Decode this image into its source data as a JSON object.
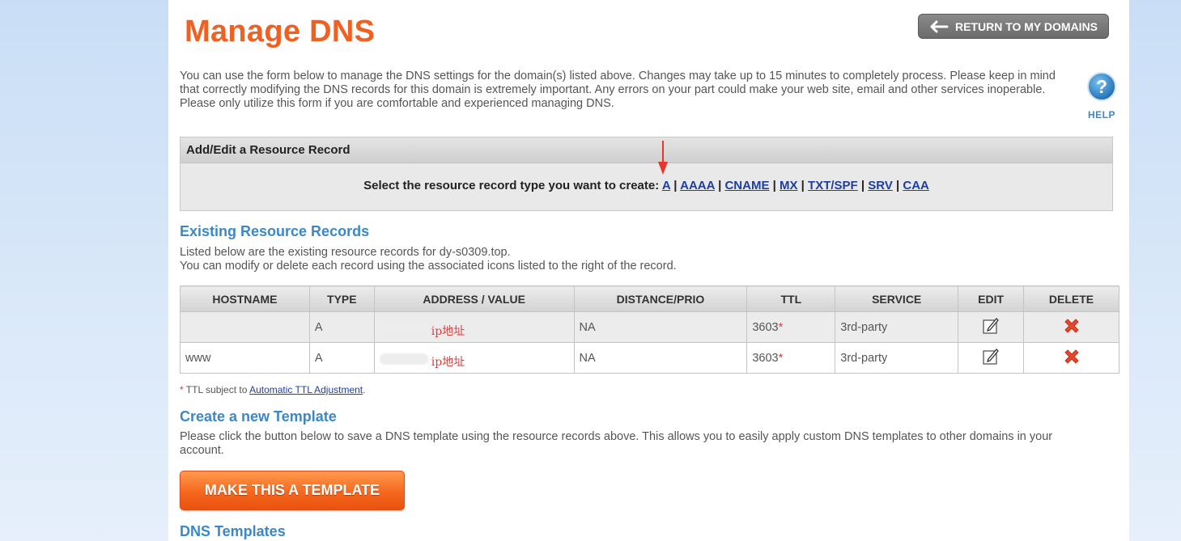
{
  "page": {
    "title": "Manage DNS",
    "return_button": "RETURN TO MY DOMAINS",
    "intro": "You can use the form below to manage the DNS settings for the domain(s) listed above. Changes may take up to 15 minutes to completely process. Please keep in mind that correctly modifying the DNS records for this domain is extremely important. Any errors on your part could make your web site, email and other services inoperable. Please only utilize this form if you are comfortable and experienced managing DNS.",
    "help_label": "HELP"
  },
  "add_record": {
    "header": "Add/Edit a Resource Record",
    "prompt": "Select the resource record type you want to create:",
    "types": [
      "A",
      "AAAA",
      "CNAME",
      "MX",
      "TXT/SPF",
      "SRV",
      "CAA"
    ]
  },
  "existing": {
    "title": "Existing Resource Records",
    "line1": "Listed below are the existing resource records for dy-s0309.top.",
    "line2": "You can modify or delete each record using the associated icons listed to the right of the record.",
    "columns": [
      "HOSTNAME",
      "TYPE",
      "ADDRESS / VALUE",
      "DISTANCE/PRIO",
      "TTL",
      "EDIT",
      "SERVICE",
      "DELETE"
    ],
    "headers": {
      "hostname": "HOSTNAME",
      "type": "TYPE",
      "address": "ADDRESS / VALUE",
      "distance": "DISTANCE/PRIO",
      "ttl": "TTL",
      "service": "SERVICE",
      "edit": "EDIT",
      "delete": "DELETE"
    },
    "rows": [
      {
        "hostname": "",
        "type": "A",
        "address_note": "ip地址",
        "distance": "NA",
        "ttl": "3603",
        "ttl_mark": "*",
        "service": "3rd-party"
      },
      {
        "hostname": "www",
        "type": "A",
        "address_note": "ip地址",
        "distance": "NA",
        "ttl": "3603",
        "ttl_mark": "*",
        "service": "3rd-party"
      }
    ],
    "ttl_note_mark": "*",
    "ttl_note_prefix": "TTL subject to",
    "ttl_note_link": "Automatic TTL Adjustment",
    "ttl_note_suffix": "."
  },
  "template": {
    "title": "Create a new Template",
    "description": "Please click the button below to save a DNS template using the resource records above. This allows you to easily apply custom DNS templates to other domains in your account.",
    "button": "MAKE THIS A TEMPLATE"
  },
  "dns_templates": {
    "title": "DNS Templates"
  },
  "colors": {
    "title_orange": "#ef6123",
    "section_blue": "#3a88c9",
    "link_blue": "#1e3fa0",
    "delete_red": "#e8462a"
  },
  "icons": {
    "return": "arrow-left-icon",
    "help": "question-mark-icon",
    "edit": "pencil-note-icon",
    "delete": "red-x-icon"
  }
}
